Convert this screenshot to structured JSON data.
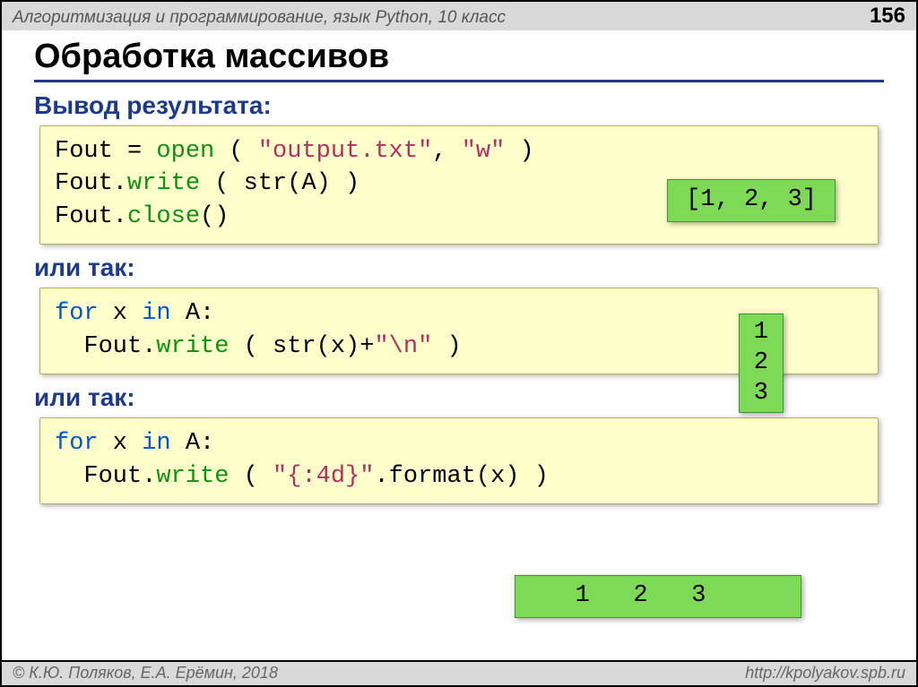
{
  "header": {
    "breadcrumb": "Алгоритмизация и программирование, язык Python, 10 класс",
    "page": "156"
  },
  "title": "Обработка массивов",
  "section1": {
    "heading": "Вывод результата:"
  },
  "code1": {
    "l1_a": "Fout",
    "l1_eq": " = ",
    "l1_fn": "open",
    "l1_b": " ( ",
    "l1_s1": "\"output.txt\"",
    "l1_c": ", ",
    "l1_s2": "\"w\"",
    "l1_d": " )",
    "l2_a": "Fout.",
    "l2_fn": "write",
    "l2_b": " ( str(A) )",
    "l3_a": "Fout.",
    "l3_fn": "close",
    "l3_b": "()"
  },
  "output1": "[1, 2, 3]",
  "section2": {
    "heading": "или так:"
  },
  "code2": {
    "l1_kw": "for",
    "l1_rest": " x ",
    "l1_in": "in",
    "l1_rest2": " A:",
    "l2_indent": "  Fout.",
    "l2_fn": "write",
    "l2_a": " ( str(x)+",
    "l2_s": "\"\\n\"",
    "l2_b": " )"
  },
  "output2": "1\n2\n3",
  "section3": {
    "heading": "или так:"
  },
  "code3": {
    "l1_kw": "for",
    "l1_rest": " x ",
    "l1_in": "in",
    "l1_rest2": " A:",
    "l2_indent": "  Fout.",
    "l2_fn": "write",
    "l2_a": " ( ",
    "l2_s": "\"{:4d}\"",
    "l2_b": ".format(x) )"
  },
  "output3": "   1   2   3",
  "footer": {
    "left": "© К.Ю. Поляков, Е.А. Ерёмин, 2018",
    "right": "http://kpolyakov.spb.ru"
  }
}
